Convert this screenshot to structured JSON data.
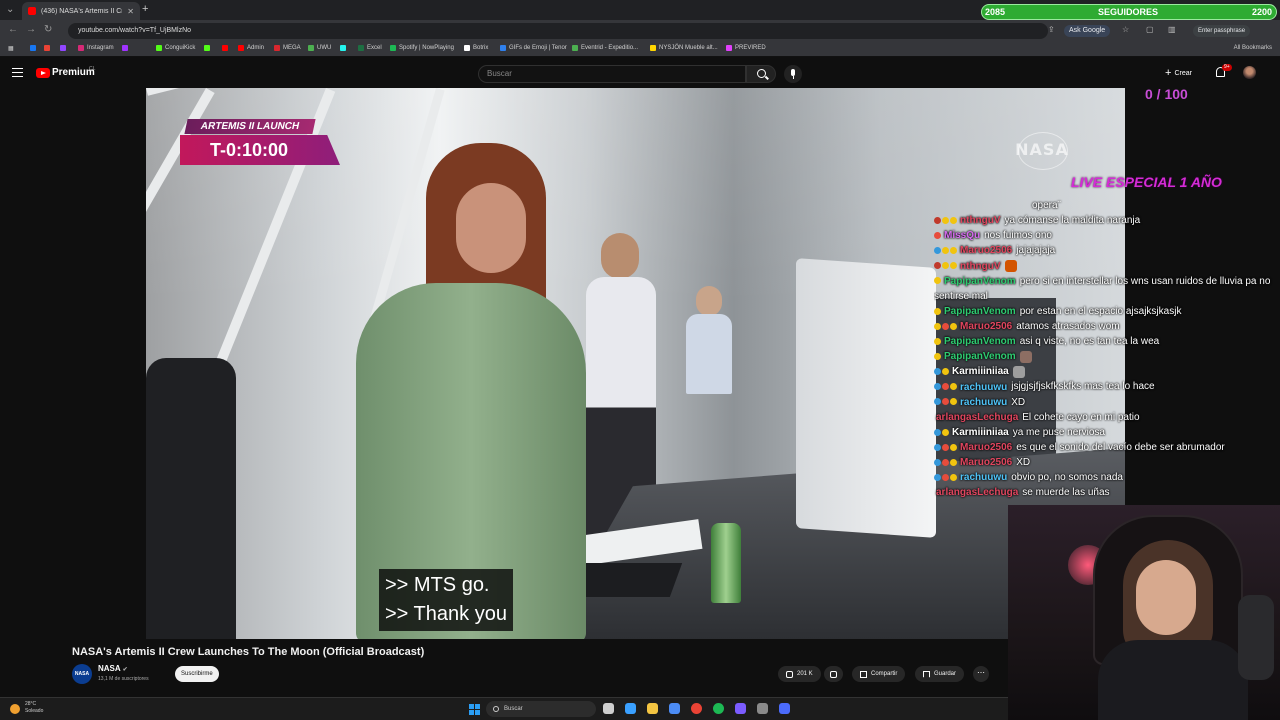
{
  "browser": {
    "tab_title": "(436) NASA's Artemis II Cre",
    "url": "youtube.com/watch?v=Tf_UjBMlzNo",
    "ask_google": "Ask Google",
    "passphrase": "Enter passphrase",
    "all_bookmarks": "All Bookmarks",
    "bookmarks": [
      {
        "label": "Instagram",
        "color": "#d62976"
      },
      {
        "label": "ConguiKick",
        "color": "#53fc18"
      },
      {
        "label": "Admin",
        "color": "#ff0000"
      },
      {
        "label": "MEGA",
        "color": "#d9272e"
      },
      {
        "label": "UWU",
        "color": "#4caf50"
      },
      {
        "label": "Excel",
        "color": "#1d6f42"
      },
      {
        "label": "Spotify | NowPlaying",
        "color": "#1db954"
      },
      {
        "label": "Botrix",
        "color": "#ffffff"
      },
      {
        "label": "GIFs de Emoji | Tenor",
        "color": "#2f80ed"
      },
      {
        "label": "Eventrid - Expeditio...",
        "color": "#4caf50"
      },
      {
        "label": "NYSJÖN Mueble alt...",
        "color": "#ffd600"
      },
      {
        "label": "PREVIRED",
        "color": "#e040fb"
      }
    ]
  },
  "followers": {
    "left": "2085",
    "label": "SEGUIDORES",
    "right": "2200"
  },
  "youtube": {
    "brand": "Premium",
    "country": "CL",
    "search_placeholder": "Buscar",
    "create_label": "Crear",
    "notif_count": "9+"
  },
  "video": {
    "launch_label": "ARTEMIS II LAUNCH",
    "countdown": "T-0:10:00",
    "nasa_logo": "NASA",
    "caption_1": ">> MTS go.",
    "caption_2": ">> Thank you",
    "title": "NASA's Artemis II Crew Launches To The Moon (Official Broadcast)",
    "channel": "NASA",
    "subscribers": "13,1 M de suscriptores",
    "subscribe_label": "Suscribirme",
    "likes": "201 K",
    "share_label": "Compartir",
    "save_label": "Guardar"
  },
  "stream": {
    "counter": "0 / 100",
    "live_title": "LIVE ESPECIAL 1 AÑO",
    "chat": [
      {
        "user": "",
        "msg": "opera¨",
        "color": "#ffffff",
        "badges": []
      },
      {
        "user": "nthnguV",
        "msg": "ya cómanse la maldita naranja",
        "color": "#e0455e",
        "badges": [
          "#c0392b",
          "#f1c40f",
          "#f1c40f"
        ]
      },
      {
        "user": "MissQu",
        "msg": "nos fuimos ono",
        "color": "#d66bf0",
        "badges": [
          "#e74c3c"
        ]
      },
      {
        "user": "Maruo2506",
        "msg": "jajajajaja",
        "color": "#e0455e",
        "badges": [
          "#3498db",
          "#f1c40f",
          "#f1c40f"
        ]
      },
      {
        "user": "nthnguV",
        "msg": "",
        "color": "#e0455e",
        "badges": [
          "#c0392b",
          "#f1c40f",
          "#f1c40f"
        ],
        "emote": "#d35400"
      },
      {
        "user": "PapipanVenom",
        "msg": "pero si en interstellar los wns usan ruidos de lluvia pa no sentirse mal",
        "color": "#2ecc71",
        "badges": [
          "#f1c40f"
        ]
      },
      {
        "user": "PapipanVenom",
        "msg": "por estan en el espacio ajsajksjkasjk",
        "color": "#2ecc71",
        "badges": [
          "#f1c40f"
        ]
      },
      {
        "user": "Maruo2506",
        "msg": "atamos atrasados wom",
        "color": "#e0455e",
        "badges": [
          "#f1c40f",
          "#e74c3c",
          "#f1c40f"
        ]
      },
      {
        "user": "PapipanVenom",
        "msg": "asi q viste, no es tan tea la wea",
        "color": "#2ecc71",
        "badges": [
          "#f1c40f"
        ]
      },
      {
        "user": "PapipanVenom",
        "msg": "",
        "color": "#2ecc71",
        "badges": [
          "#f1c40f"
        ],
        "emote": "#8d6e63"
      },
      {
        "user": "Karmiiiniiaa",
        "msg": "",
        "color": "#ffffff",
        "badges": [
          "#3498db",
          "#f1c40f"
        ],
        "emote": "#9e9e9e"
      },
      {
        "user": "rachuuwu",
        "msg": "jsjgjsjfjskfkskfks mas tea lo hace",
        "color": "#4fc3f7",
        "badges": [
          "#3498db",
          "#e74c3c",
          "#f1c40f"
        ]
      },
      {
        "user": "rachuuwu",
        "msg": "XD",
        "color": "#4fc3f7",
        "badges": [
          "#3498db",
          "#e74c3c",
          "#f1c40f"
        ]
      },
      {
        "user": "arlangasLechuga",
        "msg": "El cohete cayo en mi patio",
        "color": "#e0455e",
        "badges": []
      },
      {
        "user": "Karmiiiniiaa",
        "msg": "ya me puse nerviosa",
        "color": "#ffffff",
        "badges": [
          "#3498db",
          "#f1c40f"
        ]
      },
      {
        "user": "Maruo2506",
        "msg": "es que el sonido del vacío debe ser abrumador",
        "color": "#e0455e",
        "badges": [
          "#3498db",
          "#e74c3c",
          "#f1c40f"
        ]
      },
      {
        "user": "Maruo2506",
        "msg": "XD",
        "color": "#e0455e",
        "badges": [
          "#3498db",
          "#e74c3c",
          "#f1c40f"
        ]
      },
      {
        "user": "rachuuwu",
        "msg": "obvio po, no somos nada",
        "color": "#4fc3f7",
        "badges": [
          "#3498db",
          "#e74c3c",
          "#f1c40f"
        ]
      },
      {
        "user": "arlangasLechuga",
        "msg": "se muerde las uñas",
        "color": "#e0455e",
        "badges": []
      }
    ]
  },
  "taskbar": {
    "temperature": "28°C",
    "weather": "Soleado",
    "search_label": "Buscar",
    "apps": [
      {
        "name": "task-view-icon",
        "color": "#cfcfcf"
      },
      {
        "name": "copilot-icon",
        "color": "#3aa0ff"
      },
      {
        "name": "file-explorer-icon",
        "color": "#f4c542"
      },
      {
        "name": "store-icon",
        "color": "#4c8cf5"
      },
      {
        "name": "chrome-icon",
        "color": "#ea4335"
      },
      {
        "name": "spotify-icon",
        "color": "#1db954"
      },
      {
        "name": "app-grid-icon",
        "color": "#7b5cff"
      },
      {
        "name": "obs-icon",
        "color": "#8a8a8a"
      },
      {
        "name": "teams-icon",
        "color": "#4b6bfb"
      }
    ]
  }
}
